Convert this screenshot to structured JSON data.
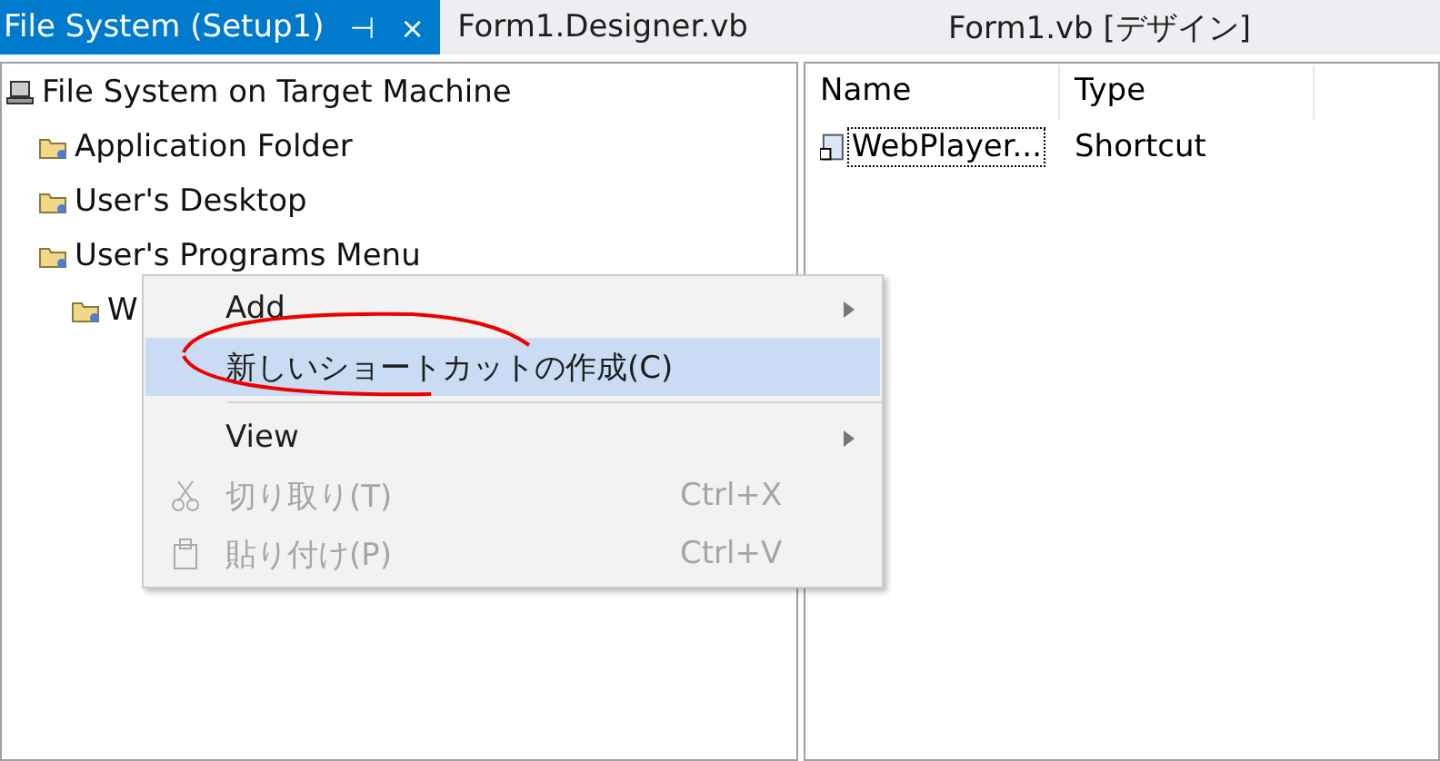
{
  "tabs": [
    {
      "label": "File System (Setup1)",
      "selected": true,
      "pin": "⊣",
      "close": "×"
    },
    {
      "label": "Form1.Designer.vb",
      "selected": false
    },
    {
      "label": "Form1.vb [デザイン]",
      "selected": false
    }
  ],
  "tree": {
    "label": "File System on Target Machine",
    "children": [
      {
        "label": "Application Folder"
      },
      {
        "label": "User's Desktop"
      },
      {
        "label": "User's Programs Menu",
        "children": [
          {
            "label": "W"
          }
        ]
      }
    ]
  },
  "list": {
    "columns": [
      "Name",
      "Type"
    ],
    "rows": [
      {
        "name": "WebPlayer...",
        "type": "Shortcut",
        "selected": true
      }
    ]
  },
  "context_menu": {
    "items": [
      {
        "kind": "item",
        "label": "Add",
        "submenu": true,
        "highlighted": false,
        "disabled": false
      },
      {
        "kind": "item",
        "label": "新しいショートカットの作成(C)",
        "submenu": false,
        "highlighted": true,
        "disabled": false
      },
      {
        "kind": "separator"
      },
      {
        "kind": "item",
        "label": "View",
        "submenu": true,
        "highlighted": false,
        "disabled": false
      },
      {
        "kind": "cut",
        "label": "切り取り(T)",
        "shortcut": "Ctrl+X",
        "submenu": false,
        "highlighted": false,
        "disabled": true
      },
      {
        "kind": "paste",
        "label": "貼り付け(P)",
        "shortcut": "Ctrl+V",
        "submenu": false,
        "highlighted": false,
        "disabled": true
      }
    ]
  }
}
